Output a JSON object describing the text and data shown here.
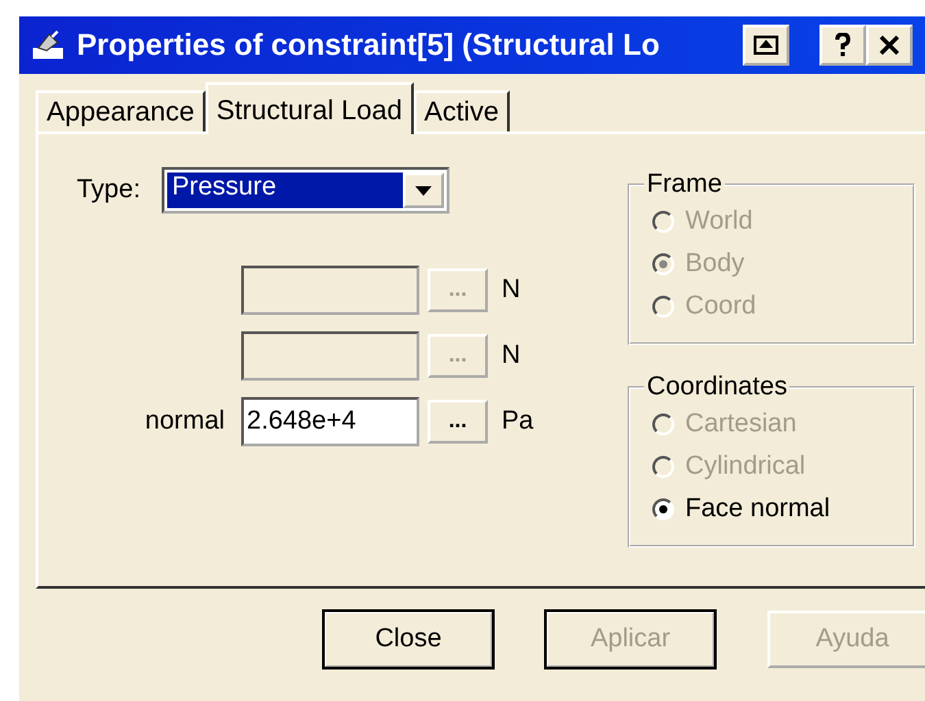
{
  "window": {
    "title": "Properties of constraint[5] (Structural Lo"
  },
  "tabs": [
    {
      "label": "Appearance",
      "selected": false
    },
    {
      "label": "Structural Load",
      "selected": true
    },
    {
      "label": "Active",
      "selected": false
    }
  ],
  "type": {
    "label": "Type:",
    "value": "Pressure"
  },
  "fields": [
    {
      "disabled": true,
      "button": "...",
      "unit": "N"
    },
    {
      "disabled": true,
      "button": "...",
      "unit": "N"
    },
    {
      "label": "normal",
      "value": "2.648e+4",
      "disabled": false,
      "button": "...",
      "unit": "Pa"
    }
  ],
  "groups": [
    {
      "title": "Frame",
      "options": [
        {
          "label": "World",
          "selected": false,
          "disabled": true
        },
        {
          "label": "Body",
          "selected": true,
          "disabled": true
        },
        {
          "label": "Coord",
          "selected": false,
          "disabled": true
        }
      ]
    },
    {
      "title": "Coordinates",
      "options": [
        {
          "label": "Cartesian",
          "selected": false,
          "disabled": true
        },
        {
          "label": "Cylindrical",
          "selected": false,
          "disabled": true
        },
        {
          "label": "Face normal",
          "selected": true,
          "disabled": false
        }
      ]
    }
  ],
  "buttons": [
    {
      "label": "Close",
      "disabled": false,
      "default": true
    },
    {
      "label": "Aplicar",
      "disabled": true,
      "default": true
    },
    {
      "label": "Ayuda",
      "disabled": true,
      "default": false
    }
  ]
}
